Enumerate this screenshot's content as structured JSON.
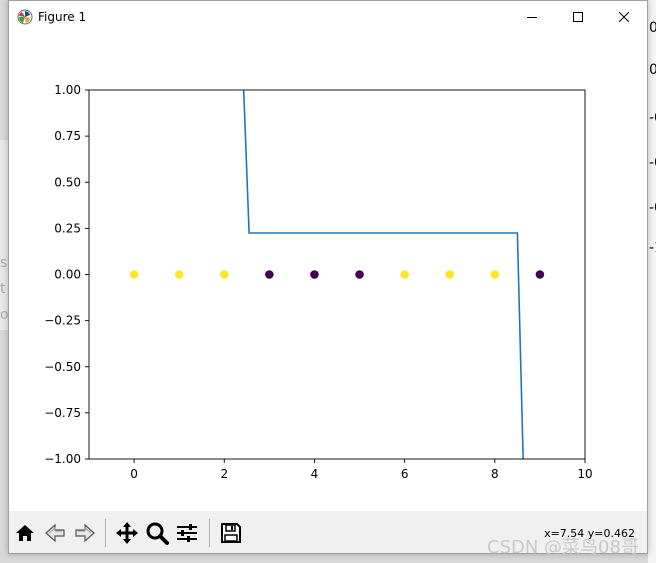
{
  "window": {
    "title": "Figure 1"
  },
  "toolbar": {
    "buttons": [
      {
        "name": "home-icon",
        "label": "Home"
      },
      {
        "name": "back-icon",
        "label": "Back"
      },
      {
        "name": "forward-icon",
        "label": "Forward"
      },
      {
        "name": "pan-icon",
        "label": "Pan"
      },
      {
        "name": "zoom-icon",
        "label": "Zoom"
      },
      {
        "name": "configure-subplots-icon",
        "label": "Subplots"
      },
      {
        "name": "save-icon",
        "label": "Save"
      }
    ],
    "coords": "x=7.54 y=0.462"
  },
  "watermark": "CSDN @菜鸟08哥",
  "background": {
    "right_glyphs": [
      "0",
      "0",
      "-0",
      "-0",
      "-0",
      "-1"
    ],
    "left_glyphs": [
      "s",
      "t",
      "o"
    ]
  },
  "chart_data": {
    "type": "line+scatter",
    "xlim": [
      -1,
      10
    ],
    "ylim": [
      -1.0,
      1.0
    ],
    "xticks": [
      0,
      2,
      4,
      6,
      8,
      10
    ],
    "yticks": [
      -1.0,
      -0.75,
      -0.5,
      -0.25,
      0.0,
      0.25,
      0.5,
      0.75,
      1.0
    ],
    "ytick_labels": [
      "−1.00",
      "−0.75",
      "−0.50",
      "−0.25",
      "0.00",
      "0.25",
      "0.50",
      "0.75",
      "1.00"
    ],
    "xtick_labels": [
      "0",
      "2",
      "4",
      "6",
      "8",
      "10"
    ],
    "line": {
      "color": "#1f77b4",
      "points": [
        [
          2.4,
          1.2
        ],
        [
          2.55,
          0.225
        ],
        [
          8.5,
          0.225
        ],
        [
          8.65,
          -1.2
        ]
      ]
    },
    "scatter": {
      "points": [
        {
          "x": 0,
          "y": 0,
          "color": "#fde725"
        },
        {
          "x": 1,
          "y": 0,
          "color": "#fde725"
        },
        {
          "x": 2,
          "y": 0,
          "color": "#fde725"
        },
        {
          "x": 3,
          "y": 0,
          "color": "#440154"
        },
        {
          "x": 4,
          "y": 0,
          "color": "#440154"
        },
        {
          "x": 5,
          "y": 0,
          "color": "#440154"
        },
        {
          "x": 6,
          "y": 0,
          "color": "#fde725"
        },
        {
          "x": 7,
          "y": 0,
          "color": "#fde725"
        },
        {
          "x": 8,
          "y": 0,
          "color": "#fde725"
        },
        {
          "x": 9,
          "y": 0,
          "color": "#440154"
        }
      ]
    }
  }
}
